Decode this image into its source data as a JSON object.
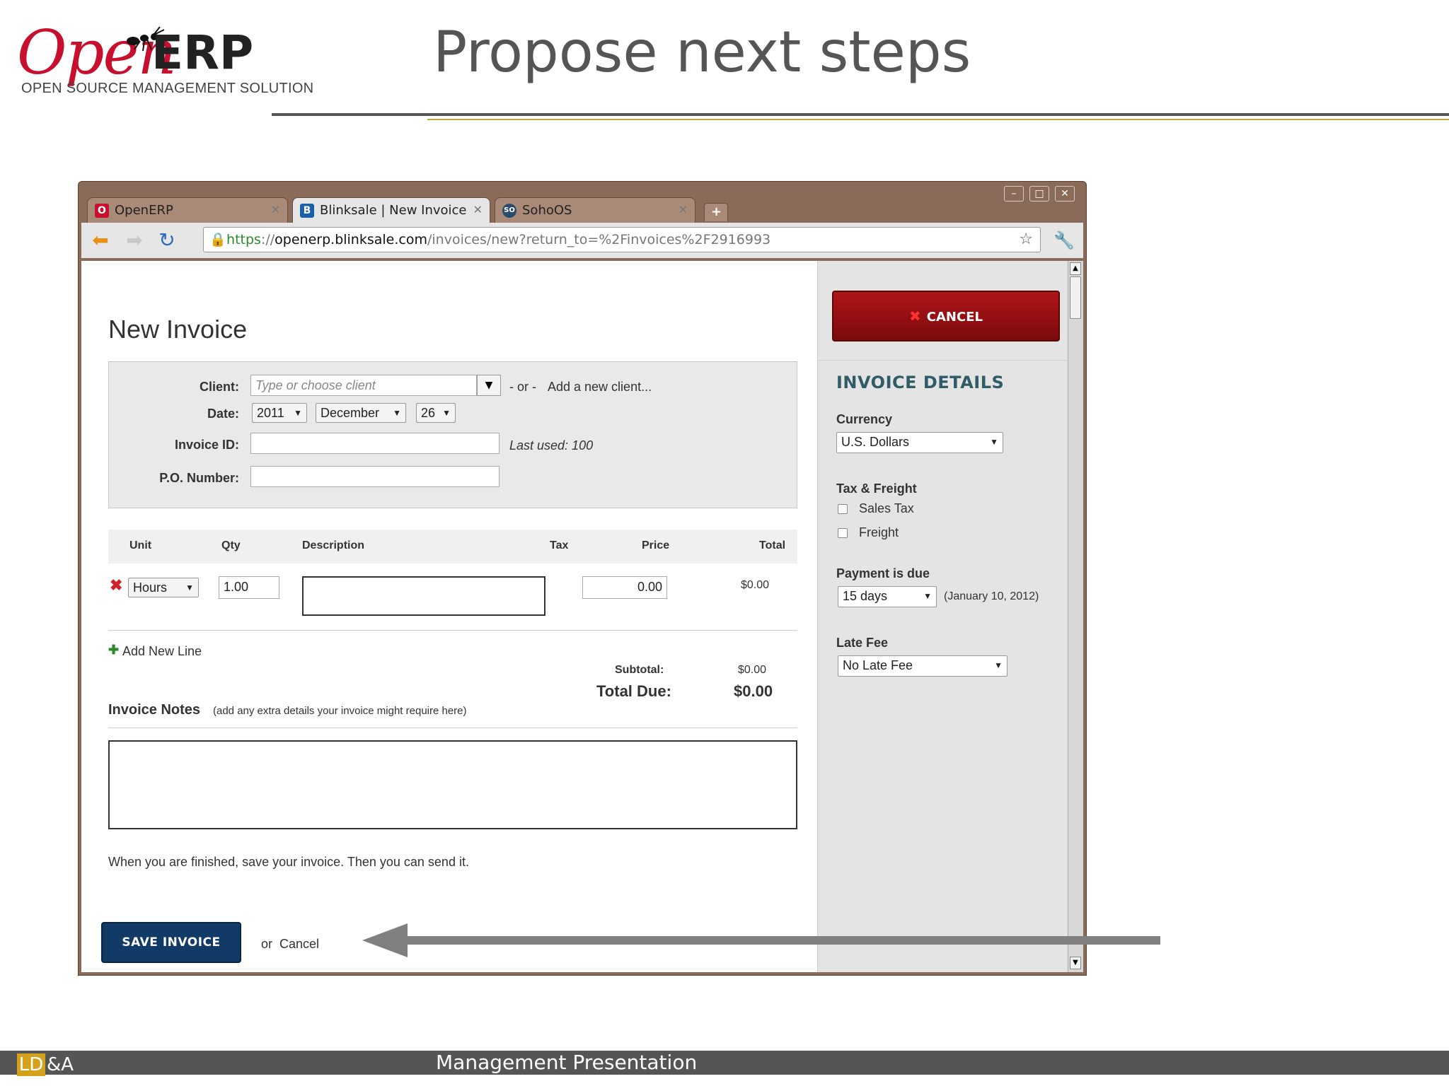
{
  "slide": {
    "logo_open": "Open",
    "logo_erp": "ERP",
    "logo_sub": "OPEN SOURCE MANAGEMENT SOLUTION",
    "title": "Propose next steps",
    "footer_ld": "LD",
    "footer_amp": "&A",
    "footer_text": "Management Presentation"
  },
  "browser": {
    "tabs": [
      {
        "label": "OpenERP",
        "icon": "openerp-icon",
        "active": false
      },
      {
        "label": "Blinksale | New Invoice",
        "icon": "blinksale-icon",
        "active": true
      },
      {
        "label": "SohoOS",
        "icon": "sohoos-icon",
        "active": false
      }
    ],
    "url_scheme": "https",
    "url_sep": "://",
    "url_host": "openerp.blinksale.com",
    "url_path": "/invoices/new?return_to=%2Finvoices%2F2916993"
  },
  "invoice": {
    "heading": "New Invoice",
    "client_label": "Client:",
    "client_placeholder": "Type or choose client",
    "or_text": "- or -",
    "add_client_link": "Add a new client...",
    "date_label": "Date:",
    "date_year": "2011",
    "date_month": "December",
    "date_day": "26",
    "invoice_id_label": "Invoice ID:",
    "last_used": "Last used: 100",
    "po_label": "P.O. Number:",
    "columns": [
      "Unit",
      "Qty",
      "Description",
      "Tax",
      "Price",
      "Total"
    ],
    "line": {
      "unit": "Hours",
      "qty": "1.00",
      "price": "0.00",
      "total": "$0.00"
    },
    "add_line": "Add New Line",
    "subtotal_label": "Subtotal:",
    "subtotal_value": "$0.00",
    "total_due_label": "Total Due:",
    "total_due_value": "$0.00",
    "notes_label": "Invoice Notes",
    "notes_hint": "(add any extra details your invoice might require here)",
    "finish_text": "When you are finished, save your invoice. Then you can send it.",
    "save_button": "SAVE INVOICE",
    "or_label": "or",
    "cancel_link": "Cancel"
  },
  "sidebar": {
    "cancel_button": "CANCEL",
    "heading": "INVOICE DETAILS",
    "currency_label": "Currency",
    "currency_value": "U.S. Dollars",
    "tax_label": "Tax & Freight",
    "sales_tax": "Sales Tax",
    "freight": "Freight",
    "payment_label": "Payment is due",
    "payment_value": "15 days",
    "payment_date": "(January 10, 2012)",
    "late_fee_label": "Late Fee",
    "late_fee_value": "No Late Fee"
  },
  "colors": {
    "accent_red": "#c8102e",
    "save_blue": "#123a66",
    "link_blue": "#1a6fb0",
    "footer_gold": "#d4a21a"
  }
}
